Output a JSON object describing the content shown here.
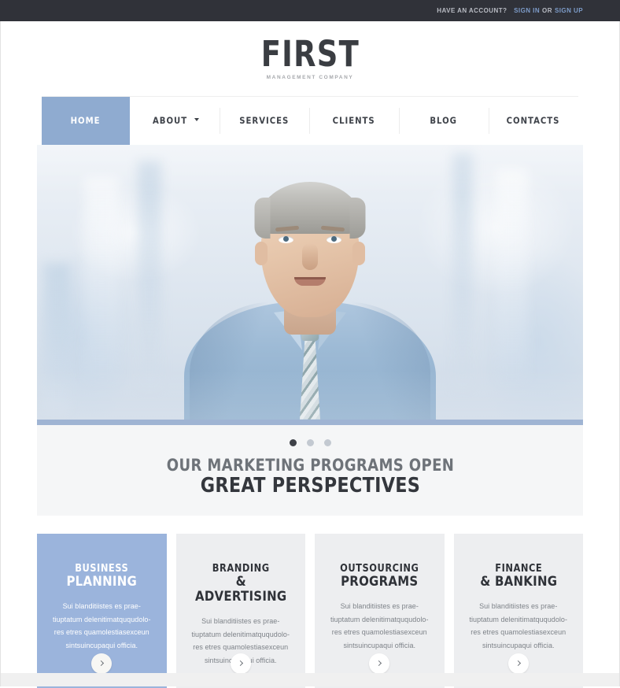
{
  "topbar": {
    "prefix": "Have an account?",
    "signin": "Sign In",
    "or": "or",
    "signup": "Sign Up"
  },
  "logo": {
    "name": "FIRST",
    "tagline": "Management Company"
  },
  "nav": {
    "items": [
      {
        "label": "Home",
        "active": true,
        "caret": false
      },
      {
        "label": "About",
        "active": false,
        "caret": true
      },
      {
        "label": "Services",
        "active": false,
        "caret": false
      },
      {
        "label": "Clients",
        "active": false,
        "caret": false
      },
      {
        "label": "Blog",
        "active": false,
        "caret": false
      },
      {
        "label": "Contacts",
        "active": false,
        "caret": false
      }
    ]
  },
  "slider": {
    "dots": [
      {
        "active": true
      },
      {
        "active": false
      },
      {
        "active": false
      }
    ],
    "caption_line1": "Our marketing programs open",
    "caption_line2": "Great Perspectives"
  },
  "cards": [
    {
      "title_line1": "Business",
      "title_line2": "Planning",
      "body": "Sui blanditiistes es prae-tiuptatum delenitimatququdolo-res etres quamolestiasexceun sintsuincupaqui officia.",
      "featured": true,
      "arrow": "chevron-right-icon"
    },
    {
      "title_line1": "Branding",
      "title_line2": "& Advertising",
      "body": "Sui blanditiistes es prae-tiuptatum delenitimatququdolo-res etres quamolestiasexceun sintsuincupaqui officia.",
      "featured": false,
      "arrow": "chevron-right-icon"
    },
    {
      "title_line1": "Outsourcing",
      "title_line2": "Programs",
      "body": "Sui blanditiistes es prae-tiuptatum delenitimatququdolo-res etres quamolestiasexceun sintsuincupaqui officia.",
      "featured": false,
      "arrow": "chevron-right-icon"
    },
    {
      "title_line1": "Finance",
      "title_line2": "& Banking",
      "body": "Sui blanditiistes es prae-tiuptatum delenitimatququdolo-res etres quamolestiasexceun sintsuincupaqui officia.",
      "featured": false,
      "arrow": "chevron-right-icon"
    }
  ],
  "colors": {
    "topbar_bg": "#303239",
    "accent_link": "#7d9cc9",
    "nav_active_bg": "#8fabd0",
    "card_featured_bg": "#9bb4dc",
    "slider_bar": "#9fb4d3",
    "caption_bg": "#f5f6f7",
    "card_bg": "#edeef0",
    "heading_dark": "#34373d",
    "heading_muted": "#6e7379",
    "body_text": "#7d8288"
  }
}
